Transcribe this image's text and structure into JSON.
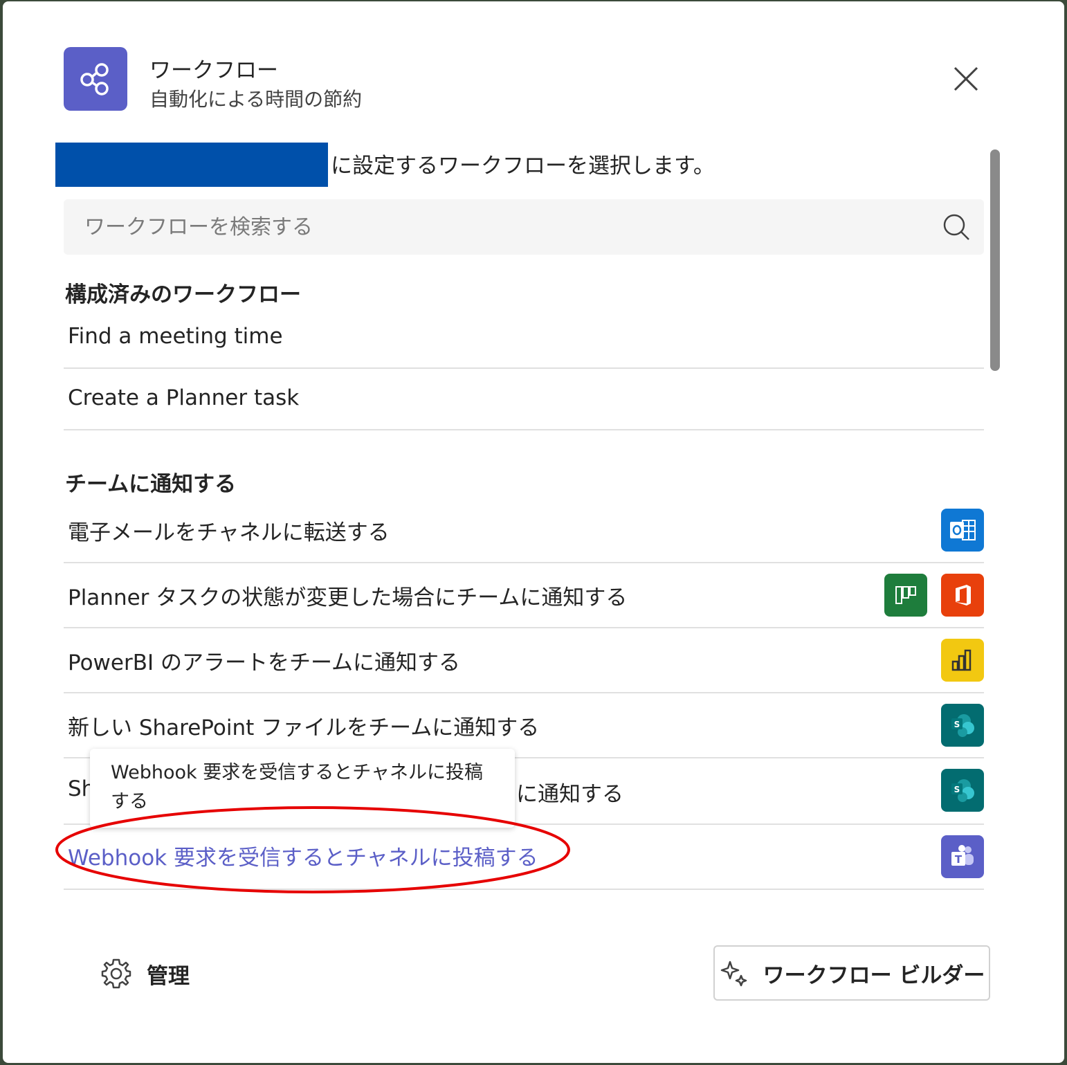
{
  "header": {
    "title": "ワークフロー",
    "subtitle": "自動化による時間の節約"
  },
  "instruction": "に設定するワークフローを選択します。",
  "search": {
    "placeholder": "ワークフローを検索する"
  },
  "configured": {
    "title": "構成済みのワークフロー",
    "items": [
      {
        "label": "Find a meeting time"
      },
      {
        "label": "Create a Planner task"
      }
    ]
  },
  "notify": {
    "title": "チームに通知する",
    "items": [
      {
        "label": "電子メールをチャネルに転送する",
        "icons": [
          "outlook-icon"
        ]
      },
      {
        "label": "Planner タスクの状態が変更した場合にチームに通知する",
        "icons": [
          "planner-icon",
          "office-icon"
        ]
      },
      {
        "label": "PowerBI のアラートをチームに通知する",
        "icons": [
          "powerbi-icon"
        ]
      },
      {
        "label": "新しい SharePoint ファイルをチームに通知する",
        "icons": [
          "sharepoint-icon"
        ]
      },
      {
        "label_start": "Sh",
        "label_end": "に通知する",
        "icons": [
          "sharepoint-icon"
        ]
      },
      {
        "label": "Webhook 要求を受信するとチャネルに投稿する",
        "icons": [
          "teams-icon"
        ]
      }
    ]
  },
  "tooltip": "Webhook 要求を受信するとチャネルに投稿する",
  "footer": {
    "manage_label": "管理",
    "builder_label": "ワークフロー ビルダー"
  },
  "colors": {
    "brand": "#5b5fc7",
    "outlook": "#0f78d4",
    "planner": "#1e7d3c",
    "office": "#e8400c",
    "powerbi": "#f2c811",
    "sharepoint": "#036c70",
    "teams": "#5b5fc7",
    "redaction": "#0050aa",
    "highlight": "#e60000"
  }
}
